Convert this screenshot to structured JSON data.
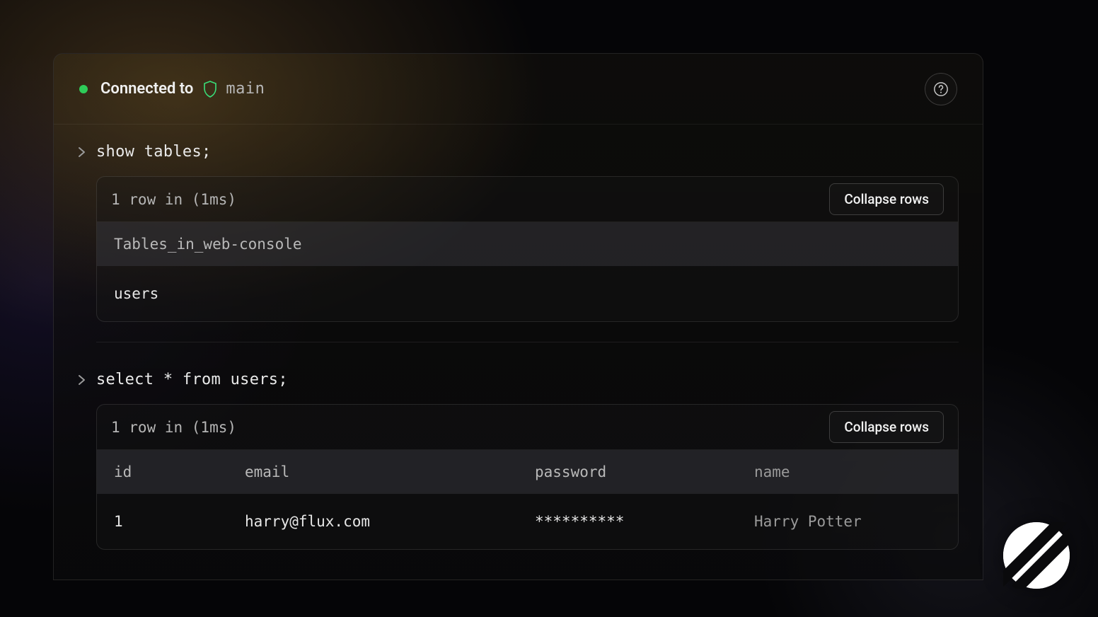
{
  "connection": {
    "status_label": "Connected to",
    "branch": "main",
    "status_dot_color": "#2ecc59"
  },
  "queries": [
    {
      "sql": "show tables;",
      "summary": "1 row in (1ms)",
      "collapse_label": "Collapse rows",
      "columns": [
        "Tables_in_web-console"
      ],
      "rows": [
        [
          "users"
        ]
      ]
    },
    {
      "sql": "select * from users;",
      "summary": "1 row in (1ms)",
      "collapse_label": "Collapse rows",
      "columns": [
        "id",
        "email",
        "password",
        "name"
      ],
      "rows": [
        [
          "1",
          "harry@flux.com",
          "**********",
          "Harry Potter"
        ]
      ]
    }
  ],
  "icons": {
    "shield": "shield-icon",
    "help": "help-icon",
    "chevron": "chevron-right-icon",
    "brand": "brand-logo-icon"
  }
}
